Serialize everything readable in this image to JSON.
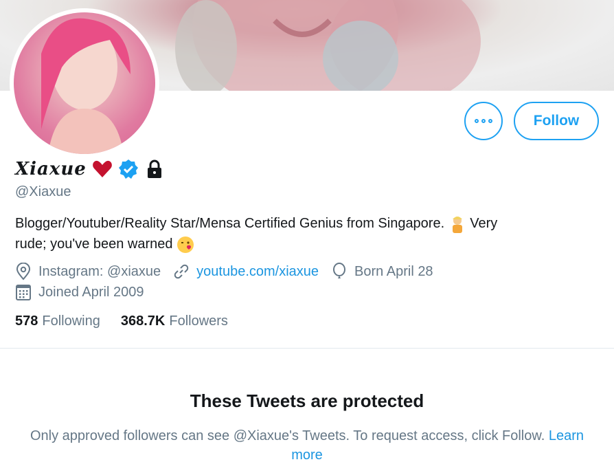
{
  "profile": {
    "display_name": "Xiaxue",
    "handle": "@Xiaxue",
    "bio_main": "Blogger/Youtuber/Reality Star/Mensa Certified Genius from Singapore.",
    "bio_tail1": "Very",
    "bio_tail2": "rude; you've been warned",
    "location": "Instagram: @xiaxue",
    "website": "youtube.com/xiaxue",
    "birthday": "Born April 28",
    "joined": "Joined April 2009"
  },
  "actions": {
    "follow_label": "Follow"
  },
  "stats": {
    "following_count": "578",
    "following_label": "Following",
    "followers_count": "368.7K",
    "followers_label": "Followers"
  },
  "protected": {
    "title": "These Tweets are protected",
    "message": "Only approved followers can see @Xiaxue's Tweets. To request access, click Follow.",
    "learn_more": "Learn more"
  },
  "colors": {
    "accent": "#1da1f2",
    "secondary_text": "#657786",
    "heart": "#e0245e"
  },
  "icons": [
    "more-icon",
    "heart-icon",
    "verified-icon",
    "lock-icon",
    "location-icon",
    "link-icon",
    "balloon-icon",
    "calendar-icon"
  ]
}
